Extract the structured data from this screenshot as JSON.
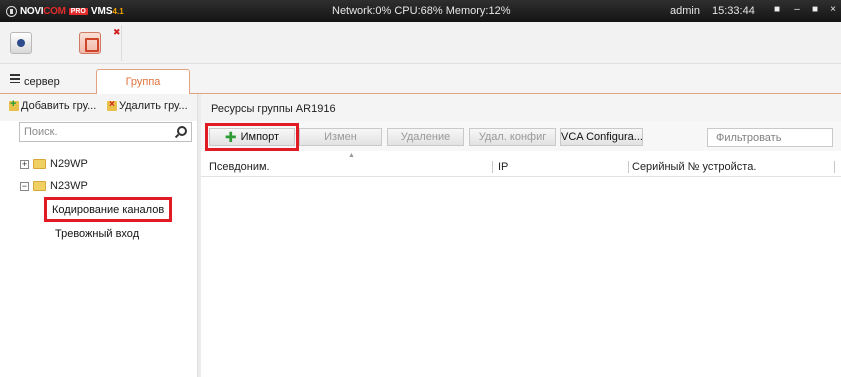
{
  "titlebar": {
    "logo": {
      "novi": "NOVI",
      "com": "COM",
      "pro": "PRO",
      "vms": "VMS",
      "version": "4.1"
    },
    "stats": "Network:0% CPU:68% Memory:12%",
    "user": "admin",
    "time": "15:33:44"
  },
  "tabs": {
    "server": "сервер",
    "group": "Группа"
  },
  "left_panel": {
    "add_group": "Добавить гру...",
    "delete_group": "Удалить гру...",
    "search_placeholder": "Поиск.",
    "tree": [
      {
        "label": "N29WP",
        "expander": "+"
      },
      {
        "label": "N23WP",
        "expander": "−"
      }
    ],
    "children": {
      "channel_encoding": "Кодирование каналов",
      "alarm_input": "Тревожный вход"
    }
  },
  "right_panel": {
    "title": "Ресурсы группы AR1916",
    "actions": {
      "import": "Импорт",
      "modify": "Измен",
      "delete": "Удаление",
      "remote_config": "Удал. конфиг",
      "vca": "VCA Configura..."
    },
    "filter_placeholder": "Фильтровать",
    "columns": {
      "alias": "Псевдоним.",
      "ip": "IP",
      "serial": "Серийный № устройста."
    }
  },
  "colors": {
    "accent": "#e07440",
    "highlight": "#e01b24",
    "titlebar": "#1e1e1e"
  }
}
